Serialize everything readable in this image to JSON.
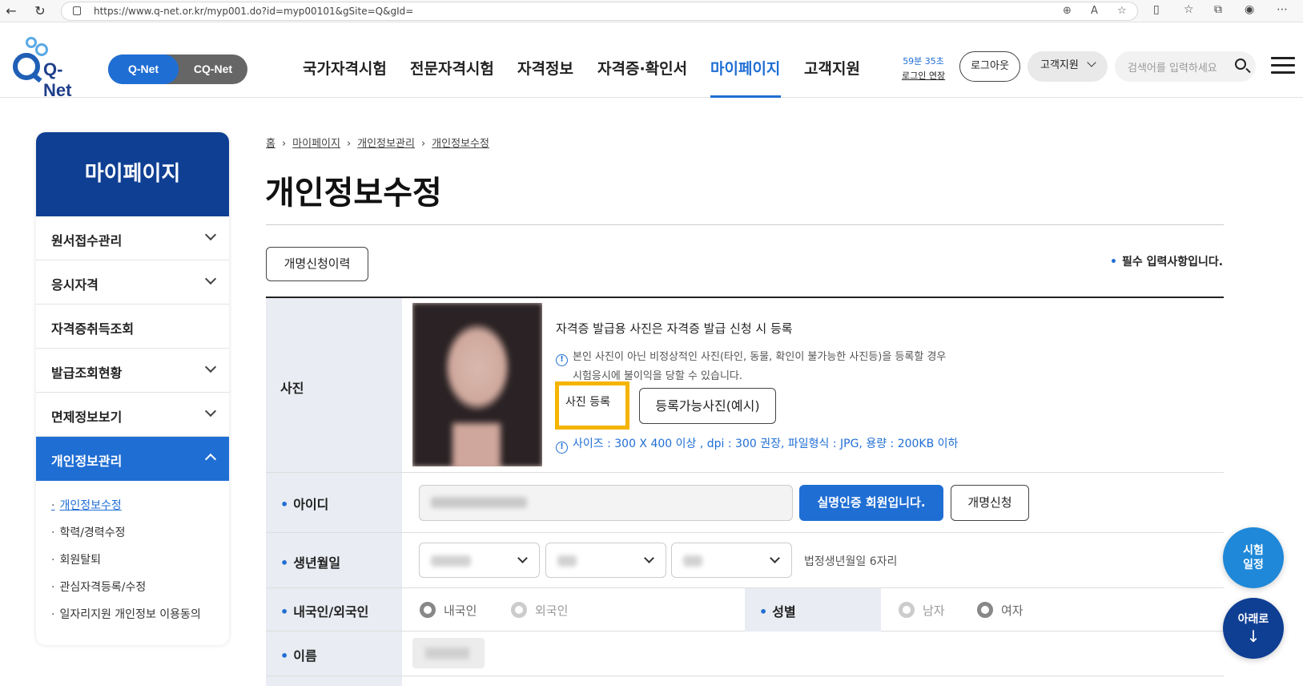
{
  "browser": {
    "url": "https://www.q-net.or.kr/myp001.do?id=myp00101&gSite=Q&gId=",
    "back_glyph": "←",
    "reload_glyph": "↻"
  },
  "header": {
    "logo_text": "Q-Net",
    "toggle": {
      "active": "Q-Net",
      "inactive": "CQ-Net"
    },
    "gnb": [
      "국가자격시험",
      "전문자격시험",
      "자격정보",
      "자격증·확인서",
      "마이페이지",
      "고객지원"
    ],
    "active_gnb": "마이페이지",
    "session_time": "59분 35초",
    "session_extend": "로그인 연장",
    "logout": "로그아웃",
    "support": "고객지원",
    "search_placeholder": "검색어를 입력하세요"
  },
  "sidebar": {
    "title": "마이페이지",
    "items": [
      {
        "label": "원서접수관리",
        "has_chevron": true
      },
      {
        "label": "응시자격",
        "has_chevron": true
      },
      {
        "label": "자격증취득조회",
        "has_chevron": false
      },
      {
        "label": "발급조회현황",
        "has_chevron": true
      },
      {
        "label": "면제정보보기",
        "has_chevron": true
      },
      {
        "label": "개인정보관리",
        "has_chevron": true,
        "active": true
      }
    ],
    "subitems": [
      "개인정보수정",
      "학력/경력수정",
      "회원탈퇴",
      "관심자격등록/수정",
      "일자리지원 개인정보 이용동의"
    ]
  },
  "breadcrumb": [
    "홈",
    "마이페이지",
    "개인정보관리",
    "개인정보수정"
  ],
  "page_title": "개인정보수정",
  "rename_history_button": "개명신청이력",
  "required_note": "필수 입력사항입니다.",
  "form": {
    "photo": {
      "label": "사진",
      "desc": "자격증 발급용 사진은 자격증 발급 신청 시 등록",
      "warn_line1": "본인 사진이 아닌 비정상적인 사진(타인, 동물, 확인이 불가능한 사진등)을 등록할 경우",
      "warn_line2": "시험응시에 불이익을 당할 수 있습니다.",
      "register_button": "사진 등록",
      "example_button": "등록가능사진(예시)",
      "spec_note": "사이즈 : 300 X 400 이상 , dpi : 300 권장, 파일형식 : JPG, 용량 : 200KB 이하"
    },
    "id": {
      "label": "아이디",
      "verified_button": "실명인증 회원입니다.",
      "rename_button": "개명신청"
    },
    "birth": {
      "label": "생년월일",
      "hint": "법정생년월일 6자리"
    },
    "nationality": {
      "label": "내국인/외국인",
      "options": [
        "내국인",
        "외국인"
      ],
      "selected": "내국인"
    },
    "gender": {
      "label": "성별",
      "options": [
        "남자",
        "여자"
      ],
      "selected": "여자"
    },
    "name": {
      "label": "이름"
    }
  },
  "fab": {
    "schedule_line1": "시험",
    "schedule_line2": "일정",
    "down_label": "아래로",
    "down_arrow": "↓"
  },
  "colors": {
    "brand_blue": "#1f6ed4",
    "navy": "#0f3f93",
    "highlight": "#f5b400"
  }
}
